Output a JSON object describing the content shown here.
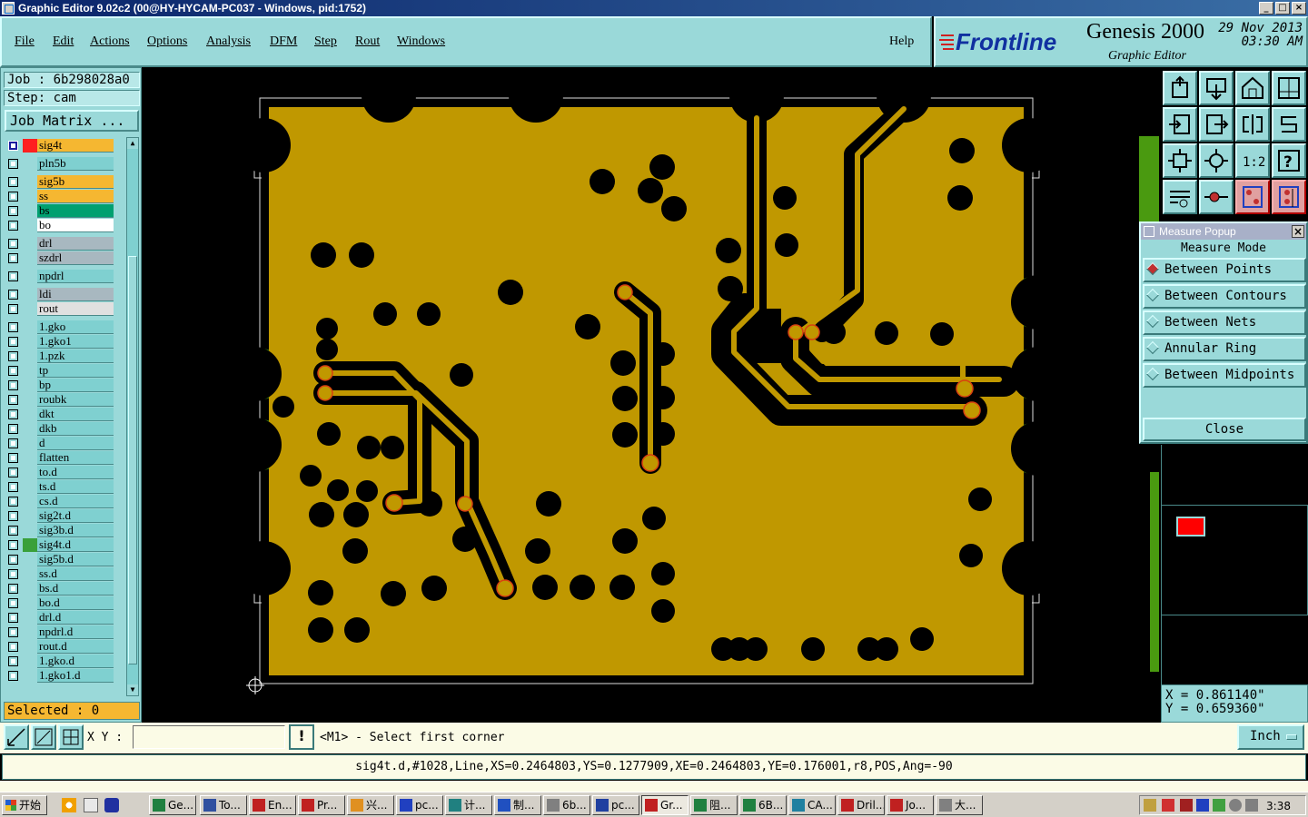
{
  "window": {
    "title": "Graphic Editor 9.02c2 (00@HY-HYCAM-PC037 - Windows, pid:1752)",
    "buttons": [
      "_",
      "□",
      "×"
    ]
  },
  "menu": [
    "File",
    "Edit",
    "Actions",
    "Options",
    "Analysis",
    "DFM",
    "Step",
    "Rout",
    "Windows",
    "Help"
  ],
  "brand": {
    "logo": "Frontline",
    "product": "Genesis 2000",
    "subtitle": "Graphic Editor",
    "date": "29 Nov 2013",
    "time": "03:30 AM"
  },
  "job": {
    "job_line": "Job : 6b298028a0",
    "step_line": "Step: cam",
    "matrix_button": "Job Matrix ..."
  },
  "layers": [
    {
      "name": "sig4t",
      "color": "#f5b731",
      "swatch": "#ff2020",
      "active": true
    },
    {
      "name": "pln5b",
      "color": "#7fd0d0",
      "swatch": "",
      "active": false
    },
    {
      "name": "sig5b",
      "color": "#f5b731",
      "swatch": "",
      "active": false
    },
    {
      "name": "ss",
      "color": "#f5b731",
      "swatch": "",
      "active": false
    },
    {
      "name": "bs",
      "color": "#00a070",
      "swatch": "",
      "active": false
    },
    {
      "name": "bo",
      "color": "#ffffff",
      "swatch": "",
      "active": false
    },
    {
      "name": "drl",
      "color": "#a8b8c0",
      "swatch": "",
      "active": false
    },
    {
      "name": "szdrl",
      "color": "#a8b8c0",
      "swatch": "",
      "active": false
    },
    {
      "name": "npdrl",
      "color": "#7fd0d0",
      "swatch": "",
      "active": false
    },
    {
      "name": "ldi",
      "color": "#a8b8c0",
      "swatch": "",
      "active": false
    },
    {
      "name": "rout",
      "color": "#e0e0e0",
      "swatch": "",
      "active": false
    },
    {
      "name": "1.gko",
      "color": "#7fd0d0",
      "swatch": "",
      "active": false
    },
    {
      "name": "1.gko1",
      "color": "#7fd0d0",
      "swatch": "",
      "active": false
    },
    {
      "name": "1.pzk",
      "color": "#7fd0d0",
      "swatch": "",
      "active": false
    },
    {
      "name": "tp",
      "color": "#7fd0d0",
      "swatch": "",
      "active": false
    },
    {
      "name": "bp",
      "color": "#7fd0d0",
      "swatch": "",
      "active": false
    },
    {
      "name": "roubk",
      "color": "#7fd0d0",
      "swatch": "",
      "active": false
    },
    {
      "name": "dkt",
      "color": "#7fd0d0",
      "swatch": "",
      "active": false
    },
    {
      "name": "dkb",
      "color": "#7fd0d0",
      "swatch": "",
      "active": false
    },
    {
      "name": "d",
      "color": "#7fd0d0",
      "swatch": "",
      "active": false
    },
    {
      "name": "flatten",
      "color": "#7fd0d0",
      "swatch": "",
      "active": false
    },
    {
      "name": "to.d",
      "color": "#7fd0d0",
      "swatch": "",
      "active": false
    },
    {
      "name": "ts.d",
      "color": "#7fd0d0",
      "swatch": "",
      "active": false
    },
    {
      "name": "cs.d",
      "color": "#7fd0d0",
      "swatch": "",
      "active": false
    },
    {
      "name": "sig2t.d",
      "color": "#7fd0d0",
      "swatch": "",
      "active": false
    },
    {
      "name": "sig3b.d",
      "color": "#7fd0d0",
      "swatch": "",
      "active": false
    },
    {
      "name": "sig4t.d",
      "color": "#7fd0d0",
      "swatch": "#3aa03a",
      "active": false
    },
    {
      "name": "sig5b.d",
      "color": "#7fd0d0",
      "swatch": "",
      "active": false
    },
    {
      "name": "ss.d",
      "color": "#7fd0d0",
      "swatch": "",
      "active": false
    },
    {
      "name": "bs.d",
      "color": "#7fd0d0",
      "swatch": "",
      "active": false
    },
    {
      "name": "bo.d",
      "color": "#7fd0d0",
      "swatch": "",
      "active": false
    },
    {
      "name": "drl.d",
      "color": "#7fd0d0",
      "swatch": "",
      "active": false
    },
    {
      "name": "npdrl.d",
      "color": "#7fd0d0",
      "swatch": "",
      "active": false
    },
    {
      "name": "rout.d",
      "color": "#7fd0d0",
      "swatch": "",
      "active": false
    },
    {
      "name": "1.gko.d",
      "color": "#7fd0d0",
      "swatch": "",
      "active": false
    },
    {
      "name": "1.gko1.d",
      "color": "#7fd0d0",
      "swatch": "",
      "active": false
    }
  ],
  "selected": "Selected : 0",
  "tools": [
    "route-up-icon",
    "drop-icon",
    "home-icon",
    "split-view-icon",
    "zoom-in-icon",
    "zoom-out-icon",
    "flip-icon",
    "snake-icon",
    "fit-icon",
    "center-icon",
    "ratio-icon",
    "help-icon",
    "measure-tool-icon",
    "net-icon",
    "layer-connect-icon",
    "layer-compare-icon"
  ],
  "tool_labels": {
    "ratio": "1:2",
    "help": "?"
  },
  "measure": {
    "title": "Measure Popup",
    "mode_label": "Measure Mode",
    "options": [
      {
        "label": "Between Points",
        "selected": true
      },
      {
        "label": "Between Contours",
        "selected": false
      },
      {
        "label": "Between Nets",
        "selected": false
      },
      {
        "label": "Annular Ring",
        "selected": false
      },
      {
        "label": "Between Midpoints",
        "selected": false
      }
    ],
    "close": "Close",
    "close_x": "×"
  },
  "coords": {
    "x": "X = 0.861140\"",
    "y": "Y = 0.659360\""
  },
  "xy_label": "X Y :",
  "xy_value": "",
  "prompt_icon": "!",
  "prompt": "<M1> - Select first corner",
  "units": "Inch",
  "feature_info": "sig4t.d,#1028,Line,XS=0.2464803,YS=0.1277909,XE=0.2464803,YE=0.176001,r8,POS,Ang=-90",
  "taskbar": {
    "start": "开始",
    "tasks": [
      "Ge...",
      "To...",
      "En...",
      "Pr...",
      "兴...",
      "pc...",
      "计...",
      "制...",
      "6b...",
      "pc...",
      "Gr...",
      "阻...",
      "6B...",
      "CA...",
      "Dril...",
      "Jo...",
      "大..."
    ],
    "active_index": 10,
    "clock": "3:38"
  },
  "colors": {
    "copper": "#c09800",
    "green_pad": "#4a9a10",
    "panel": "#9ad9d9",
    "trace_pad": "#c09800"
  }
}
